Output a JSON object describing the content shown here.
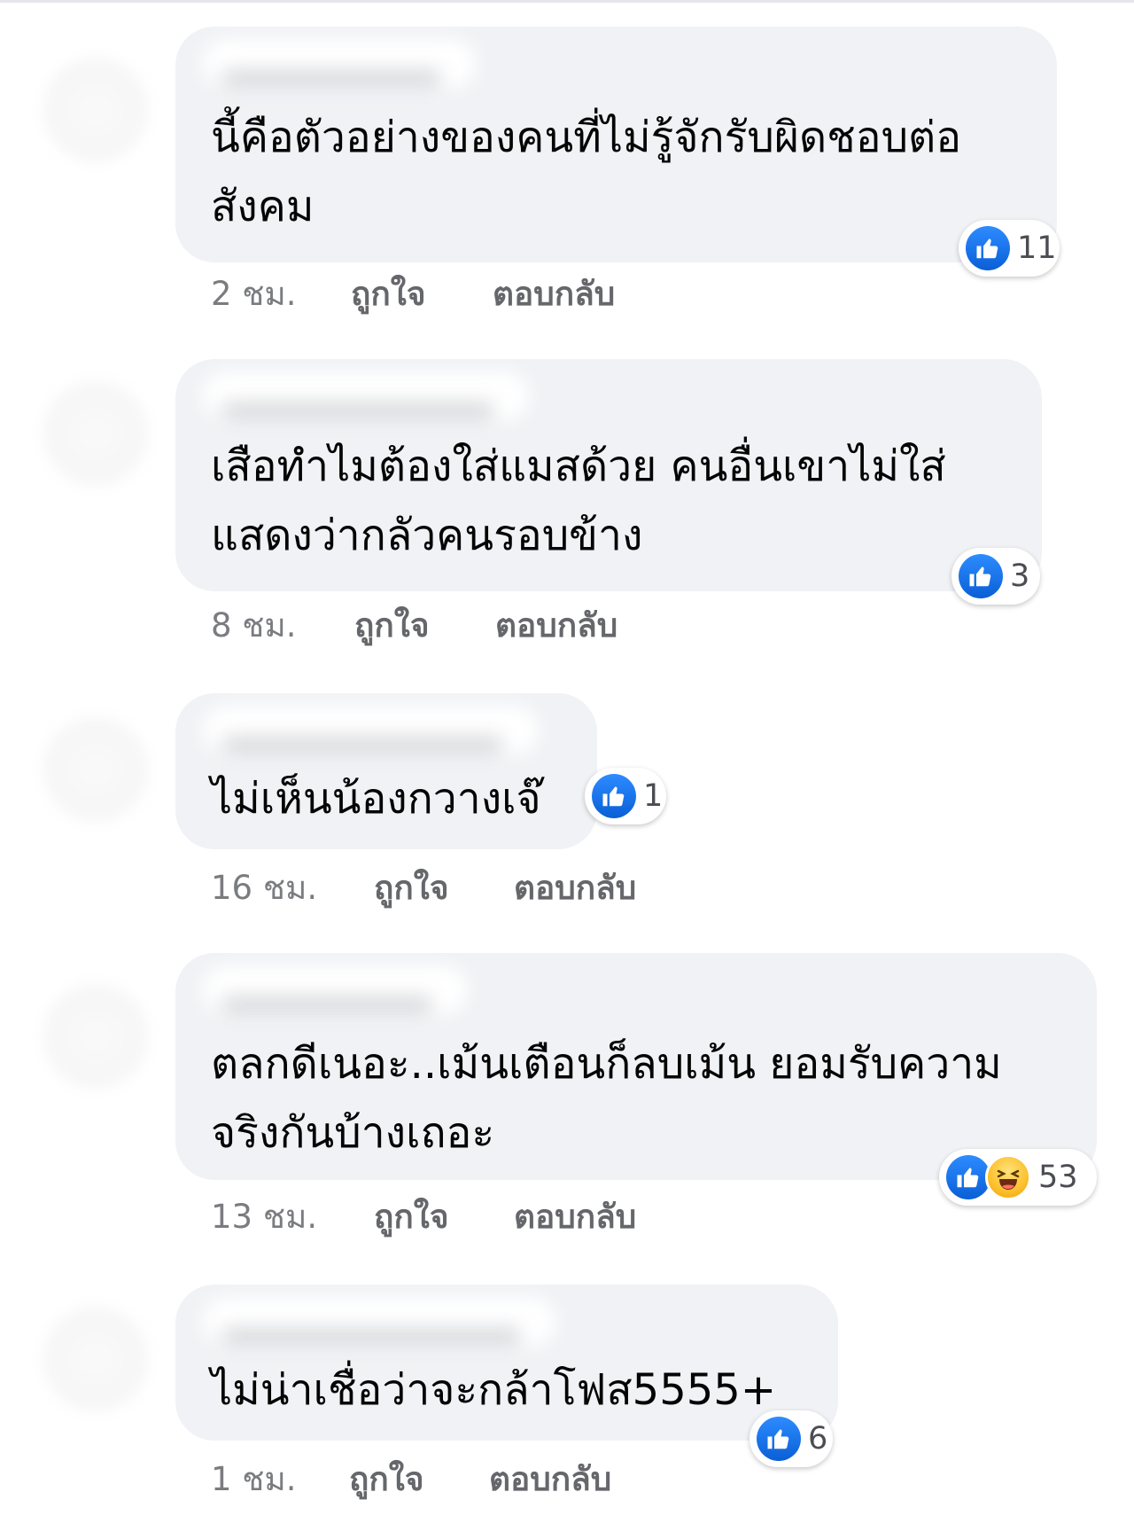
{
  "comments": [
    {
      "text": "นี้คือตัวอย่างของคนที่ไม่รู้จักรับผิดชอบต่อ\nสังคม",
      "time": "2 ชม.",
      "like_label": "ถูกใจ",
      "reply_label": "ตอบกลับ",
      "reactions": [
        "like"
      ],
      "reaction_count": "11"
    },
    {
      "text": "เสือทำไมต้องใส่แมสด้วย คนอื่นเขาไม่ใส่\nแสดงว่ากลัวคนรอบข้าง",
      "time": "8 ชม.",
      "like_label": "ถูกใจ",
      "reply_label": "ตอบกลับ",
      "reactions": [
        "like"
      ],
      "reaction_count": "3"
    },
    {
      "text": "ไม่เห็นน้องกวางเจ๊",
      "time": "16 ชม.",
      "like_label": "ถูกใจ",
      "reply_label": "ตอบกลับ",
      "reactions": [
        "like"
      ],
      "reaction_count": "1"
    },
    {
      "text": "ตลกดีเนอะ..เม้นเตือนก็ลบเม้น ยอมรับความ\nจริงกันบ้างเถอะ",
      "time": "13 ชม.",
      "like_label": "ถูกใจ",
      "reply_label": "ตอบกลับ",
      "reactions": [
        "like",
        "haha"
      ],
      "reaction_count": "53"
    },
    {
      "text": "ไม่น่าเชื่อว่าจะกล้าโฟส5555+",
      "time": "1 ชม.",
      "like_label": "ถูกใจ",
      "reply_label": "ตอบกลับ",
      "reactions": [
        "like"
      ],
      "reaction_count": "6"
    }
  ],
  "colors": {
    "bubble": "#f0f2f5",
    "text": "#050505",
    "meta": "#65676b",
    "like_blue": "#1877f2",
    "haha_yellow": "#fbc02d"
  }
}
